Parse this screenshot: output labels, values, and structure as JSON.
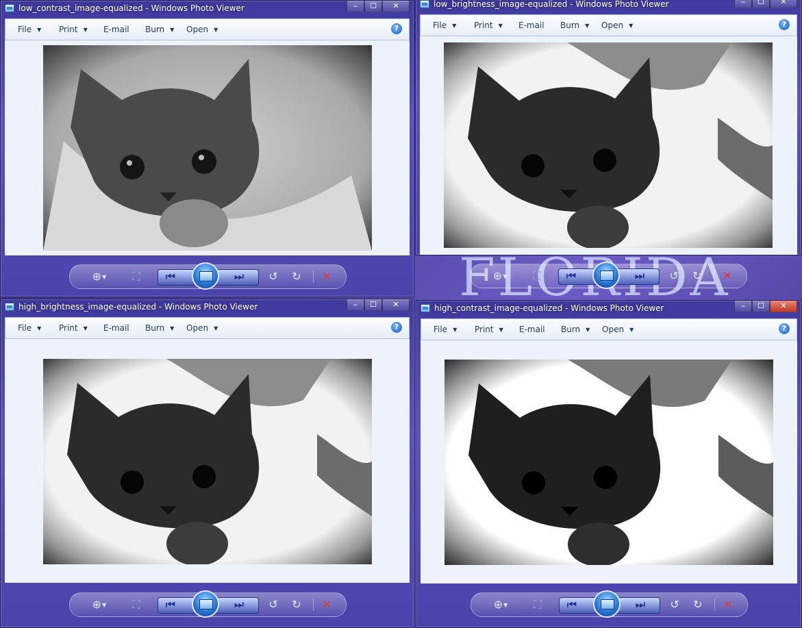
{
  "desktop": {
    "background_text": "FLORIDA"
  },
  "menu": {
    "file": "File",
    "print": "Print",
    "email": "E-mail",
    "burn": "Burn",
    "open": "Open",
    "help": "?"
  },
  "windows": [
    {
      "title": "low_contrast_image-equalized - Windows Photo Viewer",
      "variant": "low_contrast"
    },
    {
      "title": "low_brightness_image-equalized - Windows Photo Viewer",
      "variant": "equalized"
    },
    {
      "title": "high_brightness_image-equalized - Windows Photo Viewer",
      "variant": "equalized"
    },
    {
      "title": "high_contrast_image-equalized - Windows Photo Viewer",
      "variant": "equalized"
    }
  ],
  "caption": {
    "minimize": "‒",
    "maximize": "☐",
    "close": "✕"
  },
  "icons": {
    "zoom": "zoom-icon",
    "fit": "actual-size-icon",
    "prev": "previous-icon",
    "slideshow": "slideshow-icon",
    "next": "next-icon",
    "rotate_left": "rotate-counterclockwise-icon",
    "rotate_right": "rotate-clockwise-icon",
    "delete": "delete-icon"
  }
}
